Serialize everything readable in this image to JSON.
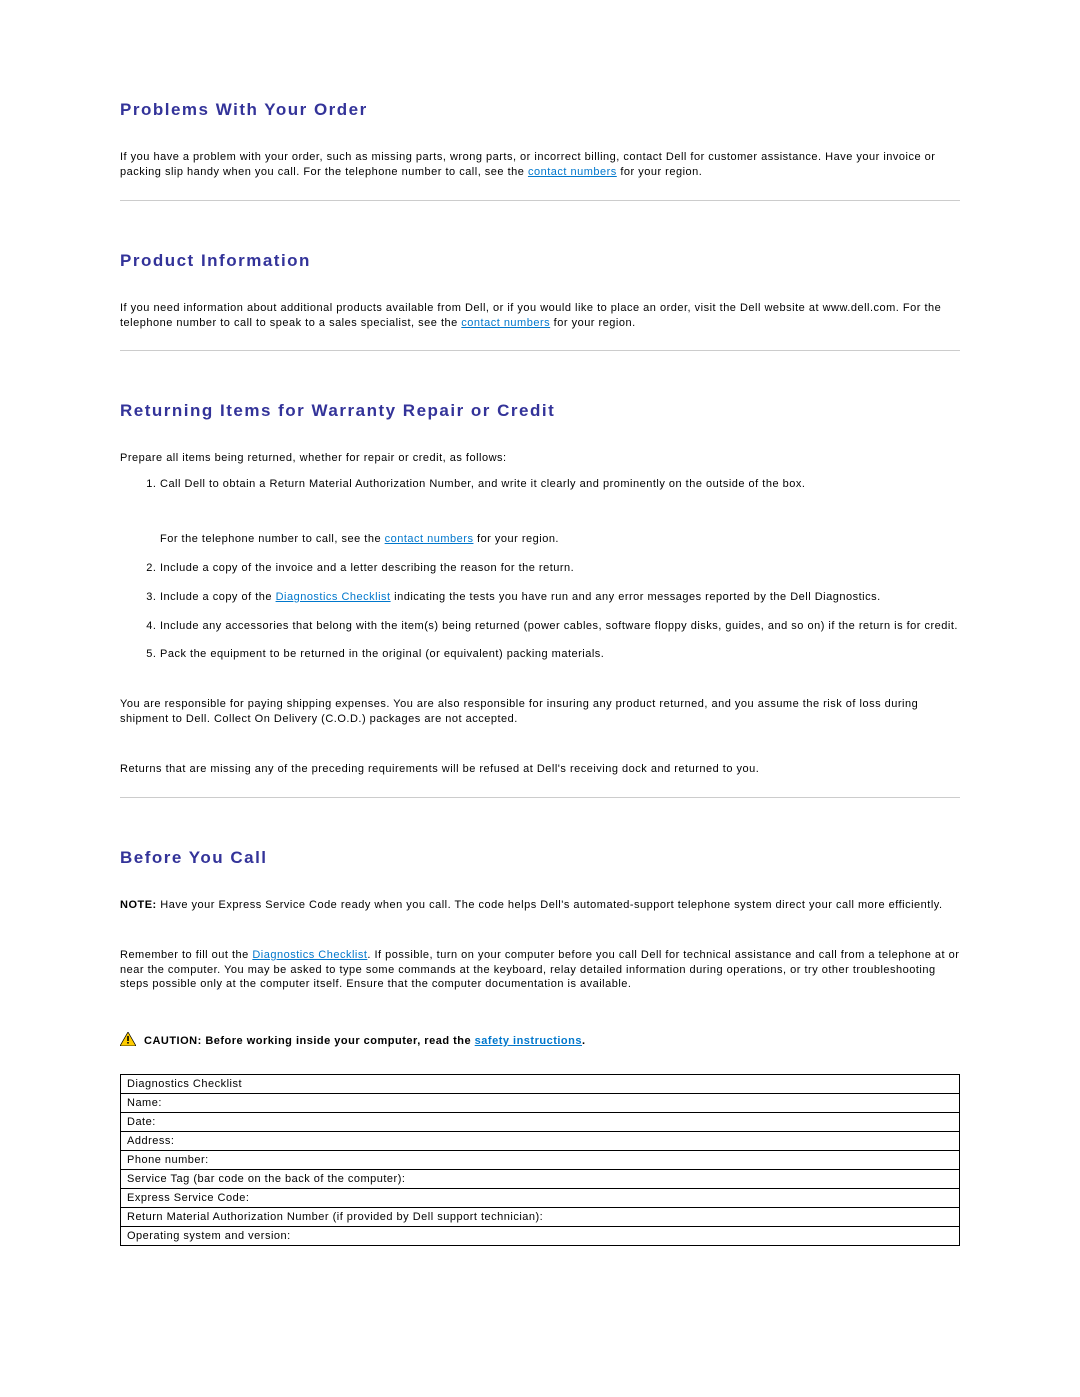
{
  "sections": {
    "problems": {
      "heading": "Problems With Your Order",
      "para_a": "If you have a problem with your order, such as missing parts, wrong parts, or incorrect billing, contact Dell for customer assistance. Have your invoice or packing slip handy when you call. For the telephone number to call, see the ",
      "link": "contact numbers",
      "para_b": " for your region."
    },
    "product": {
      "heading": "Product Information",
      "para_a": "If you need information about additional products available from Dell, or if you would like to place an order, visit the Dell website at www.dell.com. For the telephone number to call to speak to a sales specialist, see the ",
      "link": "contact numbers",
      "para_b": " for your region."
    },
    "returning": {
      "heading": "Returning Items for Warranty Repair or Credit",
      "intro": "Prepare all items being returned, whether for repair or credit, as follows:",
      "step1": "Call Dell to obtain a Return Material Authorization Number, and write it clearly and prominently on the outside of the box.",
      "step1_extra_a": "For the telephone number to call, see the ",
      "step1_extra_link": "contact numbers",
      "step1_extra_b": " for your region.",
      "step2": "Include a copy of the invoice and a letter describing the reason for the return.",
      "step3_a": "Include a copy of the ",
      "step3_link": "Diagnostics Checklist",
      "step3_b": " indicating the tests you have run and any error messages reported by the Dell Diagnostics.",
      "step4": "Include any accessories that belong with the item(s) being returned (power cables, software floppy disks, guides, and so on) if the return is for credit.",
      "step5": "Pack the equipment to be returned in the original (or equivalent) packing materials.",
      "shipping": "You are responsible for paying shipping expenses. You are also responsible for insuring any product returned, and you assume the risk of loss during shipment to Dell. Collect On Delivery (C.O.D.) packages are not accepted.",
      "refused": "Returns that are missing any of the preceding requirements will be refused at Dell's receiving dock and returned to you."
    },
    "beforecall": {
      "heading": "Before You Call",
      "note_label": "NOTE:",
      "note_text": " Have your Express Service Code ready when you call. The code helps Dell's automated-support telephone system direct your call more efficiently.",
      "remember_a": "Remember to fill out the ",
      "remember_link": "Diagnostics Checklist",
      "remember_b": ". If possible, turn on your computer before you call Dell for technical assistance and call from a telephone at or near the computer. You may be asked to type some commands at the keyboard, relay detailed information during operations, or try other troubleshooting steps possible only at the computer itself. Ensure that the computer documentation is available.",
      "caution_label": "CAUTION: ",
      "caution_text_a": "Before working inside your computer, read the ",
      "caution_link": "safety instructions",
      "caution_text_b": "."
    }
  },
  "checklist": {
    "title": "Diagnostics Checklist",
    "rows": [
      "Name:",
      "Date:",
      "Address:",
      "Phone number:",
      "Service Tag (bar code on the back of the computer):",
      "Express Service Code:",
      "Return Material Authorization Number (if provided by Dell support technician):",
      "Operating system and version:"
    ]
  }
}
